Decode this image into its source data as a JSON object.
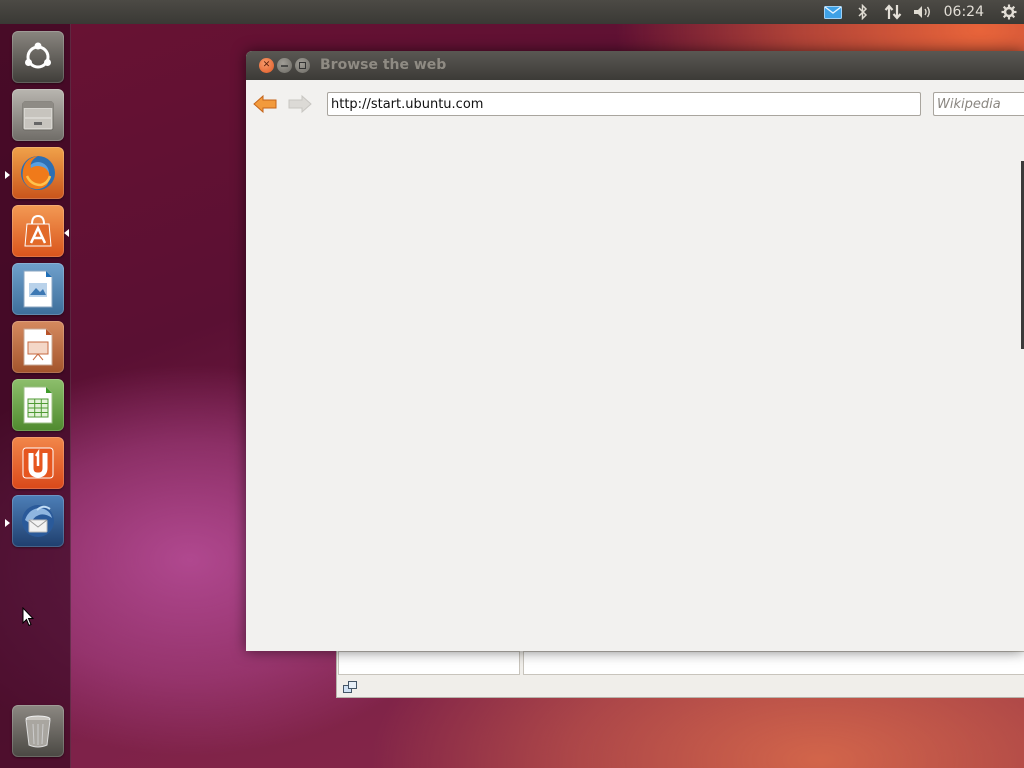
{
  "top_panel": {
    "clock": "06:24",
    "indicators": [
      "mail-icon",
      "bluetooth-icon",
      "network-icon",
      "volume-icon"
    ],
    "session_icon": "gear-icon"
  },
  "launcher": {
    "items": [
      {
        "name": "dash-home",
        "icon": "ubuntu-logo-icon"
      },
      {
        "name": "files",
        "icon": "file-cabinet-icon"
      },
      {
        "name": "firefox",
        "icon": "firefox-icon",
        "running": true
      },
      {
        "name": "software-center",
        "icon": "shopping-bag-icon",
        "focused": true
      },
      {
        "name": "writer",
        "icon": "document-icon"
      },
      {
        "name": "impress",
        "icon": "presentation-icon"
      },
      {
        "name": "calc",
        "icon": "spreadsheet-icon"
      },
      {
        "name": "ubuntu-one",
        "icon": "ubuntu-one-icon"
      },
      {
        "name": "thunderbird",
        "icon": "thunderbird-icon",
        "running": true
      }
    ],
    "trash_icon": "trash-icon"
  },
  "window": {
    "title": "Browse the web",
    "url": "http://start.ubuntu.com",
    "search_placeholder": "Wikipedia",
    "back_icon": "arrow-left-icon",
    "forward_icon": "arrow-right-icon"
  },
  "colors": {
    "accent_orange": "#dd4814",
    "panel": "#3c3b37",
    "window_bg": "#f2f1ef"
  }
}
